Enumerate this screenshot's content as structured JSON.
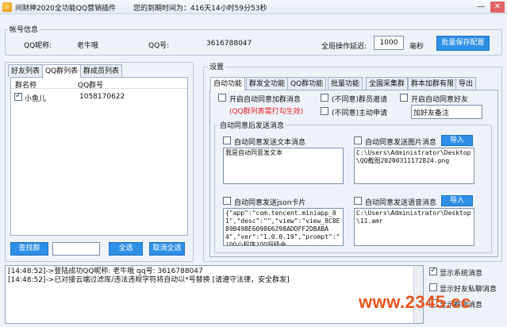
{
  "window": {
    "title": "问财神2020全功能QQ营销插件",
    "status": "您的到期时间为：416天14小时59分53秒",
    "controls": {
      "minimize": "—",
      "close": "✕"
    }
  },
  "account": {
    "group_title": "帐号信息",
    "nickname_label": "QQ昵称:",
    "nickname": "老牛哦",
    "qq_label": "QQ号:",
    "qq": "3616788047",
    "delay_label": "全局操作延迟:",
    "delay_value": "1000",
    "delay_unit": "毫秒",
    "save_button": "批量保存配置"
  },
  "left_panel": {
    "tabs": [
      "好友列表",
      "QQ群列表",
      "群成员列表"
    ],
    "active_tab": 1,
    "columns": [
      "群名称",
      "QQ群号"
    ],
    "rows": [
      {
        "name": "小鱼儿",
        "number": "1058170622",
        "checked": true
      }
    ],
    "find_button": "查找群",
    "search_value": "",
    "select_all": "全选",
    "deselect_all": "取消全选"
  },
  "settings": {
    "group_title": "设置",
    "tabs": [
      "自动功能",
      "群发全功能",
      "QQ群功能",
      "批量功能",
      "全国采集群",
      "群本加群有限",
      "导出"
    ],
    "active_tab": 0,
    "opt_auto_join_group": "开启自动同意加群消息",
    "opt_member_invite": "(不同意)群员邀请",
    "opt_auto_agree_friend": "开启自动同意好友",
    "hint_red": "(QQ群列表需打勾生效)",
    "opt_active_apply": "(不同意)主动申请",
    "friend_note": "加好友备注",
    "after_agree_title": "自动同意后发送消息",
    "send_text_label": "自动同意发送文本消息",
    "send_text_value": "我是自动同意发文本",
    "send_image_label": "自动同意发送图片消息",
    "import_image": "导入",
    "image_path": "C:\\Users\\Administrator\\Desktop\\QQ截图20200311172824.png",
    "send_json_label": "自动同意发送json卡片",
    "json_value": "{\"app\":\"com.tencent.miniapp_01\",\"desc\":\"\",\"view\":\"view_8C8E89B49BE609866298ADDFF2DBABA4\",\"ver\":\"1.0.0.19\",\"prompt\":\"[QQ小程序]QQ超级会",
    "send_voice_label": "自动同意发送语音消息",
    "import_voice": "导入",
    "voice_path": "C:\\Users\\Administrator\\Desktop\\11.amr"
  },
  "log": {
    "lines": [
      "[14:48:52]->登陆成功QQ昵称: 老牛哦 qq号: 3616788047",
      "[14:48:52]->已对接云端过滤库/违法违规字符将自动以*号替换 [请遵守法律，安全群发]"
    ],
    "show_system": "显示系统消息",
    "show_private": "显示好友私聊消息",
    "show_group": "显示群聊消息",
    "show_system_checked": true,
    "show_private_checked": false
  },
  "watermark": "www.2345.cc"
}
